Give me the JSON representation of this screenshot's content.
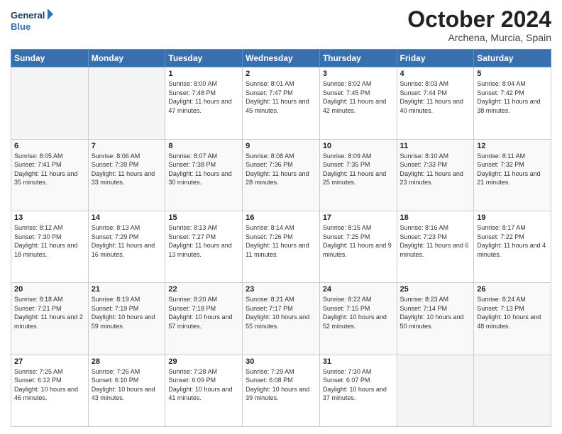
{
  "header": {
    "logo_line1": "General",
    "logo_line2": "Blue",
    "month_title": "October 2024",
    "location": "Archena, Murcia, Spain"
  },
  "days_of_week": [
    "Sunday",
    "Monday",
    "Tuesday",
    "Wednesday",
    "Thursday",
    "Friday",
    "Saturday"
  ],
  "weeks": [
    [
      {
        "day": "",
        "info": ""
      },
      {
        "day": "",
        "info": ""
      },
      {
        "day": "1",
        "info": "Sunrise: 8:00 AM\nSunset: 7:48 PM\nDaylight: 11 hours and 47 minutes."
      },
      {
        "day": "2",
        "info": "Sunrise: 8:01 AM\nSunset: 7:47 PM\nDaylight: 11 hours and 45 minutes."
      },
      {
        "day": "3",
        "info": "Sunrise: 8:02 AM\nSunset: 7:45 PM\nDaylight: 11 hours and 42 minutes."
      },
      {
        "day": "4",
        "info": "Sunrise: 8:03 AM\nSunset: 7:44 PM\nDaylight: 11 hours and 40 minutes."
      },
      {
        "day": "5",
        "info": "Sunrise: 8:04 AM\nSunset: 7:42 PM\nDaylight: 11 hours and 38 minutes."
      }
    ],
    [
      {
        "day": "6",
        "info": "Sunrise: 8:05 AM\nSunset: 7:41 PM\nDaylight: 11 hours and 35 minutes."
      },
      {
        "day": "7",
        "info": "Sunrise: 8:06 AM\nSunset: 7:39 PM\nDaylight: 11 hours and 33 minutes."
      },
      {
        "day": "8",
        "info": "Sunrise: 8:07 AM\nSunset: 7:38 PM\nDaylight: 11 hours and 30 minutes."
      },
      {
        "day": "9",
        "info": "Sunrise: 8:08 AM\nSunset: 7:36 PM\nDaylight: 11 hours and 28 minutes."
      },
      {
        "day": "10",
        "info": "Sunrise: 8:09 AM\nSunset: 7:35 PM\nDaylight: 11 hours and 25 minutes."
      },
      {
        "day": "11",
        "info": "Sunrise: 8:10 AM\nSunset: 7:33 PM\nDaylight: 11 hours and 23 minutes."
      },
      {
        "day": "12",
        "info": "Sunrise: 8:11 AM\nSunset: 7:32 PM\nDaylight: 11 hours and 21 minutes."
      }
    ],
    [
      {
        "day": "13",
        "info": "Sunrise: 8:12 AM\nSunset: 7:30 PM\nDaylight: 11 hours and 18 minutes."
      },
      {
        "day": "14",
        "info": "Sunrise: 8:13 AM\nSunset: 7:29 PM\nDaylight: 11 hours and 16 minutes."
      },
      {
        "day": "15",
        "info": "Sunrise: 8:13 AM\nSunset: 7:27 PM\nDaylight: 11 hours and 13 minutes."
      },
      {
        "day": "16",
        "info": "Sunrise: 8:14 AM\nSunset: 7:26 PM\nDaylight: 11 hours and 11 minutes."
      },
      {
        "day": "17",
        "info": "Sunrise: 8:15 AM\nSunset: 7:25 PM\nDaylight: 11 hours and 9 minutes."
      },
      {
        "day": "18",
        "info": "Sunrise: 8:16 AM\nSunset: 7:23 PM\nDaylight: 11 hours and 6 minutes."
      },
      {
        "day": "19",
        "info": "Sunrise: 8:17 AM\nSunset: 7:22 PM\nDaylight: 11 hours and 4 minutes."
      }
    ],
    [
      {
        "day": "20",
        "info": "Sunrise: 8:18 AM\nSunset: 7:21 PM\nDaylight: 11 hours and 2 minutes."
      },
      {
        "day": "21",
        "info": "Sunrise: 8:19 AM\nSunset: 7:19 PM\nDaylight: 10 hours and 59 minutes."
      },
      {
        "day": "22",
        "info": "Sunrise: 8:20 AM\nSunset: 7:18 PM\nDaylight: 10 hours and 57 minutes."
      },
      {
        "day": "23",
        "info": "Sunrise: 8:21 AM\nSunset: 7:17 PM\nDaylight: 10 hours and 55 minutes."
      },
      {
        "day": "24",
        "info": "Sunrise: 8:22 AM\nSunset: 7:15 PM\nDaylight: 10 hours and 52 minutes."
      },
      {
        "day": "25",
        "info": "Sunrise: 8:23 AM\nSunset: 7:14 PM\nDaylight: 10 hours and 50 minutes."
      },
      {
        "day": "26",
        "info": "Sunrise: 8:24 AM\nSunset: 7:13 PM\nDaylight: 10 hours and 48 minutes."
      }
    ],
    [
      {
        "day": "27",
        "info": "Sunrise: 7:25 AM\nSunset: 6:12 PM\nDaylight: 10 hours and 46 minutes."
      },
      {
        "day": "28",
        "info": "Sunrise: 7:26 AM\nSunset: 6:10 PM\nDaylight: 10 hours and 43 minutes."
      },
      {
        "day": "29",
        "info": "Sunrise: 7:28 AM\nSunset: 6:09 PM\nDaylight: 10 hours and 41 minutes."
      },
      {
        "day": "30",
        "info": "Sunrise: 7:29 AM\nSunset: 6:08 PM\nDaylight: 10 hours and 39 minutes."
      },
      {
        "day": "31",
        "info": "Sunrise: 7:30 AM\nSunset: 6:07 PM\nDaylight: 10 hours and 37 minutes."
      },
      {
        "day": "",
        "info": ""
      },
      {
        "day": "",
        "info": ""
      }
    ]
  ]
}
